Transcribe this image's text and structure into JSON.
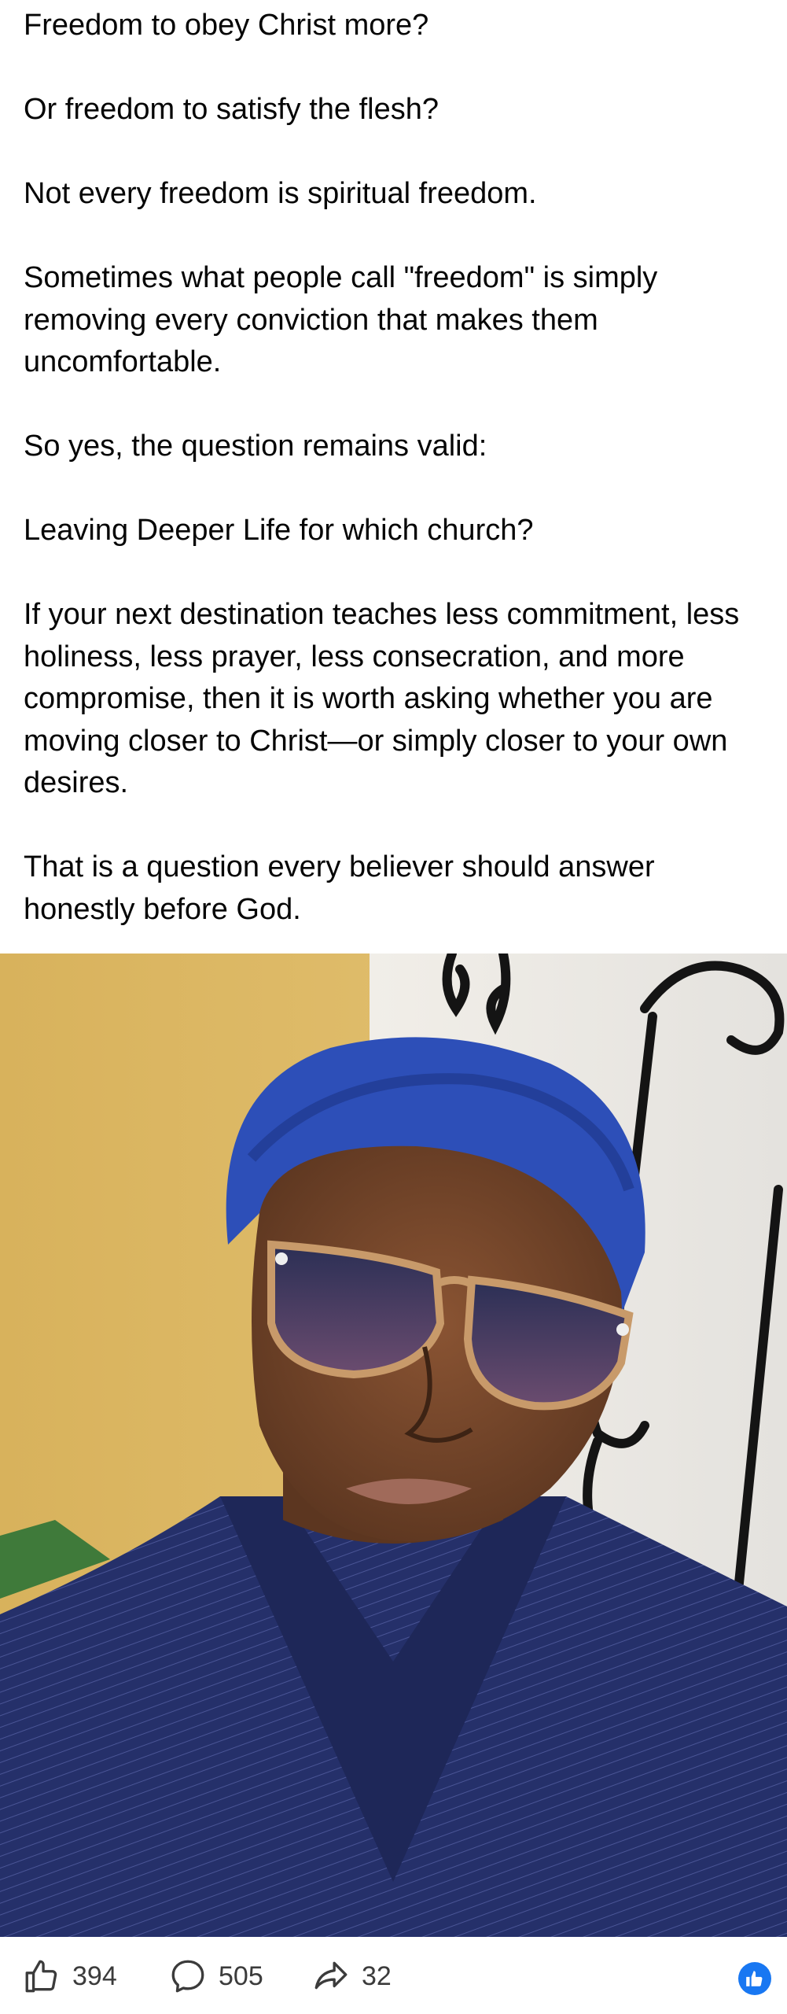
{
  "post": {
    "paragraphs": [
      "Freedom to obey Christ more?",
      "Or freedom to satisfy the flesh?",
      "Not every freedom is spiritual freedom.",
      "Sometimes what people call \"freedom\" is simply removing every conviction that makes them uncomfortable.",
      "So yes, the question remains valid:",
      "Leaving Deeper Life for which church?",
      "If your next destination teaches less commitment, less holiness, less prayer, less consecration, and more compromise, then it is worth asking whether you are moving closer to Christ—or simply closer to your own desires.",
      "That is a question every believer should answer honestly before God."
    ]
  },
  "photo": {
    "icon": "portrait-photo",
    "colors": {
      "wall": "#d9b35e",
      "headwrap": "#2d4fb8",
      "outfit": "#26306b",
      "skin": "#7a4a2e"
    }
  },
  "actions": {
    "like_count": "394",
    "comment_count": "505",
    "share_count": "32",
    "like_icon": "thumbs-up-icon",
    "comment_icon": "comment-bubble-icon",
    "share_icon": "share-arrow-icon",
    "reaction_icon": "like-reaction-icon",
    "reaction_color": "#1877f2"
  }
}
